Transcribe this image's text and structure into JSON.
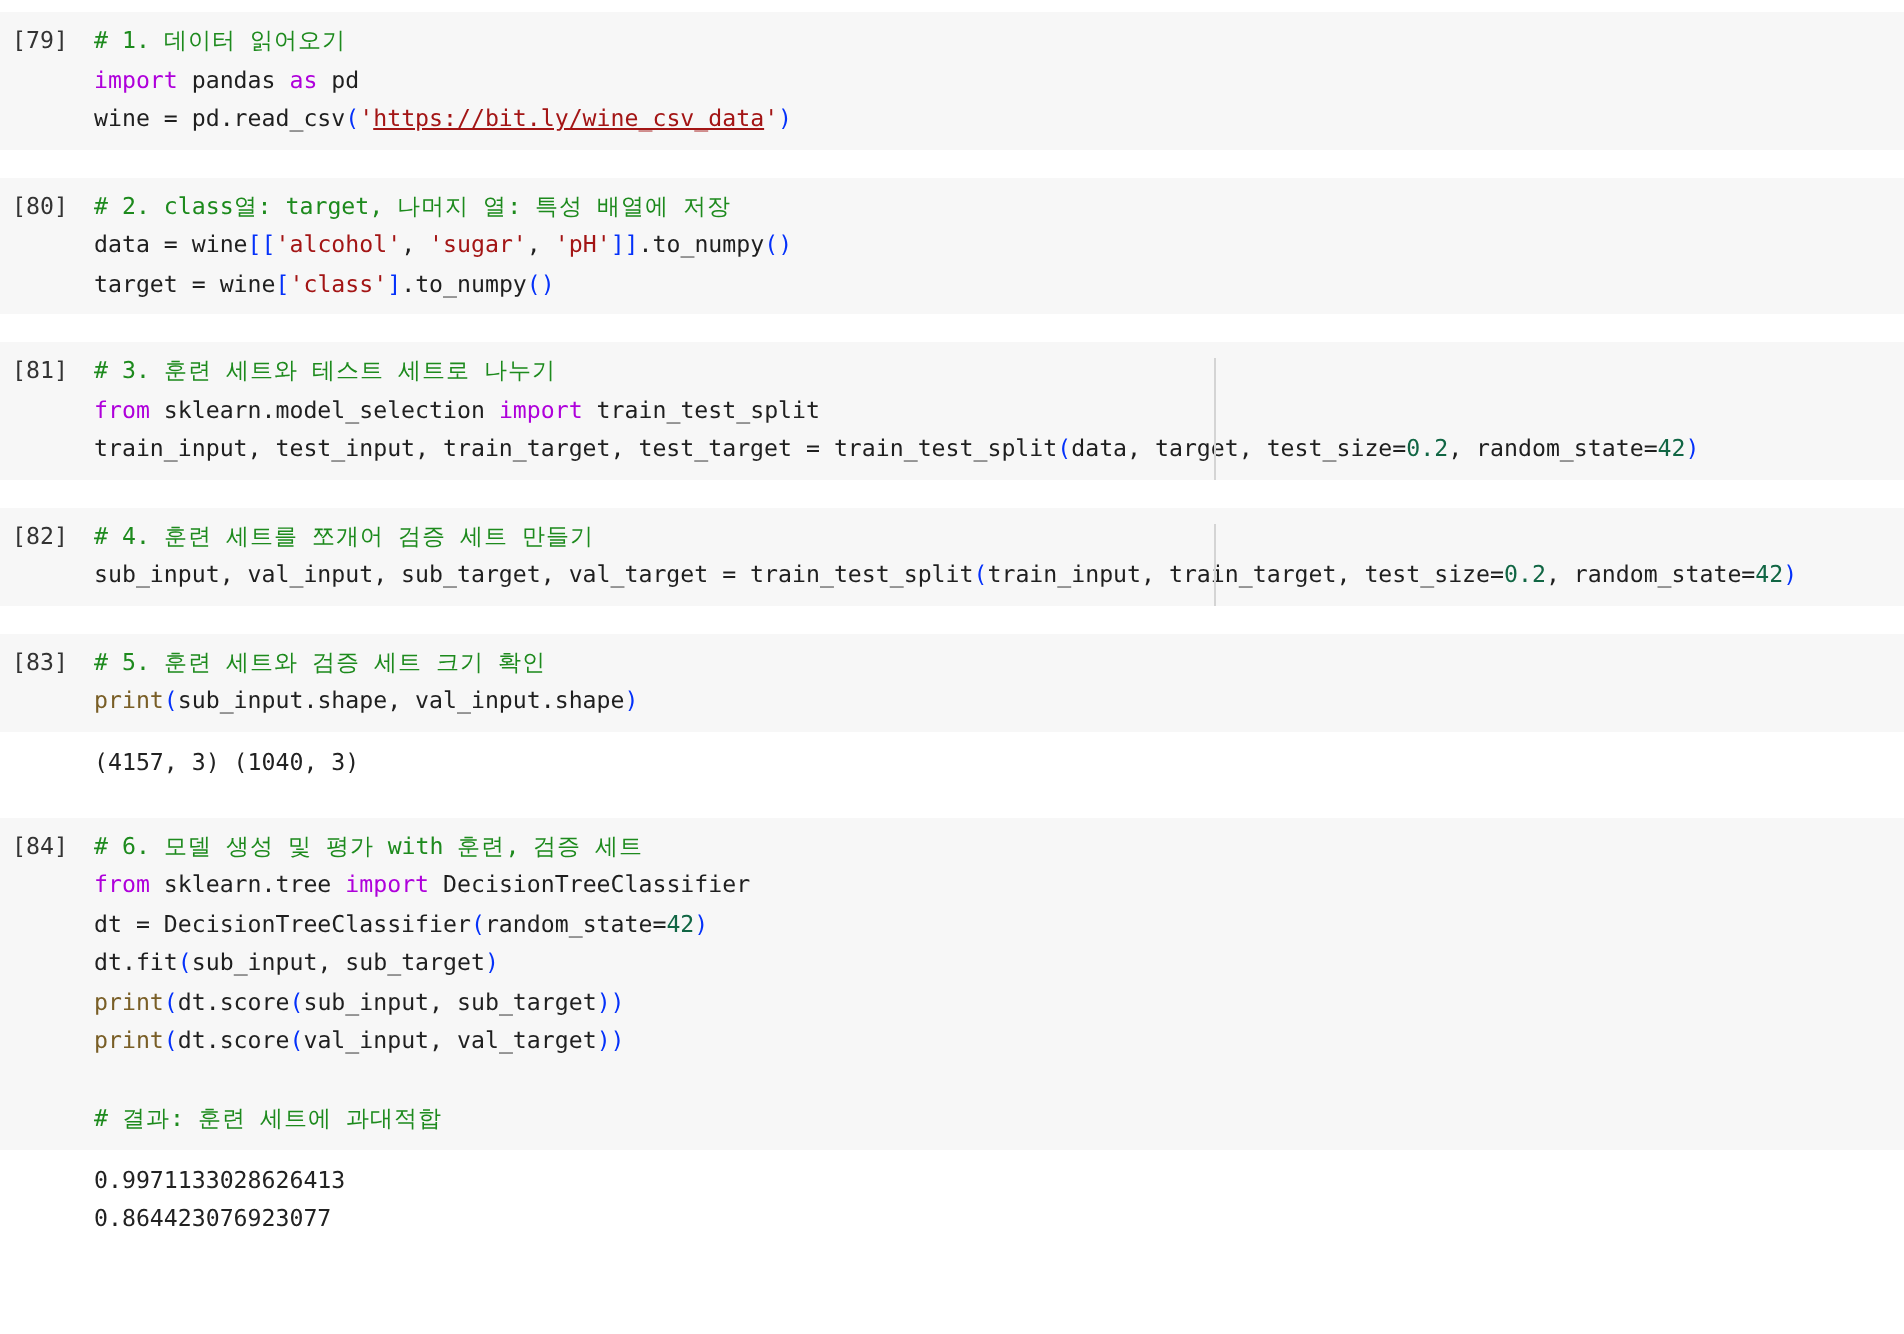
{
  "cells": [
    {
      "prompt": "[79]",
      "ruler": false,
      "lines": [
        {
          "tokens": [
            {
              "kind": "comment",
              "text": "# 1. 데이터 읽어오기"
            }
          ]
        },
        {
          "tokens": [
            {
              "kind": "keyword",
              "text": "import"
            },
            {
              "kind": "text",
              "text": " pandas "
            },
            {
              "kind": "keyword",
              "text": "as"
            },
            {
              "kind": "text",
              "text": " pd"
            }
          ]
        },
        {
          "tokens": [
            {
              "kind": "text",
              "text": "wine = pd.read_csv"
            },
            {
              "kind": "paren",
              "text": "("
            },
            {
              "kind": "string",
              "text": "'"
            },
            {
              "kind": "link",
              "text": "https://bit.ly/wine_csv_data"
            },
            {
              "kind": "string",
              "text": "'"
            },
            {
              "kind": "paren",
              "text": ")"
            }
          ]
        }
      ]
    },
    {
      "prompt": "[80]",
      "ruler": false,
      "lines": [
        {
          "tokens": [
            {
              "kind": "comment",
              "text": "# 2. class열: target, 나머지 열: 특성 배열에 저장"
            }
          ]
        },
        {
          "tokens": [
            {
              "kind": "text",
              "text": "data = wine"
            },
            {
              "kind": "paren",
              "text": "[["
            },
            {
              "kind": "string",
              "text": "'alcohol'"
            },
            {
              "kind": "text",
              "text": ", "
            },
            {
              "kind": "string",
              "text": "'sugar'"
            },
            {
              "kind": "text",
              "text": ", "
            },
            {
              "kind": "string",
              "text": "'pH'"
            },
            {
              "kind": "paren",
              "text": "]]"
            },
            {
              "kind": "text",
              "text": ".to_numpy"
            },
            {
              "kind": "paren",
              "text": "()"
            }
          ]
        },
        {
          "tokens": [
            {
              "kind": "text",
              "text": "target = wine"
            },
            {
              "kind": "paren",
              "text": "["
            },
            {
              "kind": "string",
              "text": "'class'"
            },
            {
              "kind": "paren",
              "text": "]"
            },
            {
              "kind": "text",
              "text": ".to_numpy"
            },
            {
              "kind": "paren",
              "text": "()"
            }
          ]
        }
      ]
    },
    {
      "prompt": "[81]",
      "ruler": true,
      "lines": [
        {
          "tokens": [
            {
              "kind": "comment",
              "text": "# 3. 훈련 세트와 테스트 세트로 나누기"
            }
          ]
        },
        {
          "tokens": [
            {
              "kind": "keyword",
              "text": "from"
            },
            {
              "kind": "text",
              "text": " sklearn.model_selection "
            },
            {
              "kind": "keyword",
              "text": "import"
            },
            {
              "kind": "text",
              "text": " train_test_split"
            }
          ]
        },
        {
          "tokens": [
            {
              "kind": "text",
              "text": "train_input, test_input, train_target, test_target = train_test_split"
            },
            {
              "kind": "paren",
              "text": "("
            },
            {
              "kind": "text",
              "text": "data, target, test_size="
            },
            {
              "kind": "number",
              "text": "0.2"
            },
            {
              "kind": "text",
              "text": ", random_state="
            },
            {
              "kind": "number",
              "text": "42"
            },
            {
              "kind": "paren",
              "text": ")"
            }
          ]
        }
      ]
    },
    {
      "prompt": "[82]",
      "ruler": true,
      "lines": [
        {
          "tokens": [
            {
              "kind": "comment",
              "text": "# 4. 훈련 세트를 쪼개어 검증 세트 만들기"
            }
          ]
        },
        {
          "tokens": [
            {
              "kind": "text",
              "text": "sub_input, val_input, sub_target, val_target = train_test_split"
            },
            {
              "kind": "paren",
              "text": "("
            },
            {
              "kind": "text",
              "text": "train_input, train_target, test_size="
            },
            {
              "kind": "number",
              "text": "0.2"
            },
            {
              "kind": "text",
              "text": ", random_state="
            },
            {
              "kind": "number",
              "text": "42"
            },
            {
              "kind": "paren",
              "text": ")"
            }
          ]
        }
      ]
    },
    {
      "prompt": "[83]",
      "ruler": false,
      "lines": [
        {
          "tokens": [
            {
              "kind": "comment",
              "text": "# 5. 훈련 세트와 검증 세트 크기 확인"
            }
          ]
        },
        {
          "tokens": [
            {
              "kind": "builtin",
              "text": "print"
            },
            {
              "kind": "paren",
              "text": "("
            },
            {
              "kind": "text",
              "text": "sub_input.shape, val_input.shape"
            },
            {
              "kind": "paren",
              "text": ")"
            }
          ]
        }
      ],
      "output": [
        "(4157, 3) (1040, 3)"
      ]
    },
    {
      "prompt": "[84]",
      "ruler": false,
      "lines": [
        {
          "tokens": [
            {
              "kind": "comment",
              "text": "# 6. 모델 생성 및 평가 with 훈련, 검증 세트"
            }
          ]
        },
        {
          "tokens": [
            {
              "kind": "keyword",
              "text": "from"
            },
            {
              "kind": "text",
              "text": " sklearn.tree "
            },
            {
              "kind": "keyword",
              "text": "import"
            },
            {
              "kind": "text",
              "text": " DecisionTreeClassifier"
            }
          ]
        },
        {
          "tokens": [
            {
              "kind": "text",
              "text": "dt = DecisionTreeClassifier"
            },
            {
              "kind": "paren",
              "text": "("
            },
            {
              "kind": "text",
              "text": "random_state="
            },
            {
              "kind": "number",
              "text": "42"
            },
            {
              "kind": "paren",
              "text": ")"
            }
          ]
        },
        {
          "tokens": [
            {
              "kind": "text",
              "text": "dt.fit"
            },
            {
              "kind": "paren",
              "text": "("
            },
            {
              "kind": "text",
              "text": "sub_input, sub_target"
            },
            {
              "kind": "paren",
              "text": ")"
            }
          ]
        },
        {
          "tokens": [
            {
              "kind": "builtin",
              "text": "print"
            },
            {
              "kind": "paren",
              "text": "("
            },
            {
              "kind": "text",
              "text": "dt.score"
            },
            {
              "kind": "paren",
              "text": "("
            },
            {
              "kind": "text",
              "text": "sub_input, sub_target"
            },
            {
              "kind": "paren",
              "text": "))"
            }
          ]
        },
        {
          "tokens": [
            {
              "kind": "builtin",
              "text": "print"
            },
            {
              "kind": "paren",
              "text": "("
            },
            {
              "kind": "text",
              "text": "dt.score"
            },
            {
              "kind": "paren",
              "text": "("
            },
            {
              "kind": "text",
              "text": "val_input, val_target"
            },
            {
              "kind": "paren",
              "text": "))"
            }
          ]
        },
        {
          "blank_before": true,
          "tokens": [
            {
              "kind": "comment",
              "text": "# 결과: 훈련 세트에 과대적합"
            }
          ]
        }
      ],
      "output": [
        "0.9971133028626413",
        "0.864423076923077"
      ]
    }
  ]
}
